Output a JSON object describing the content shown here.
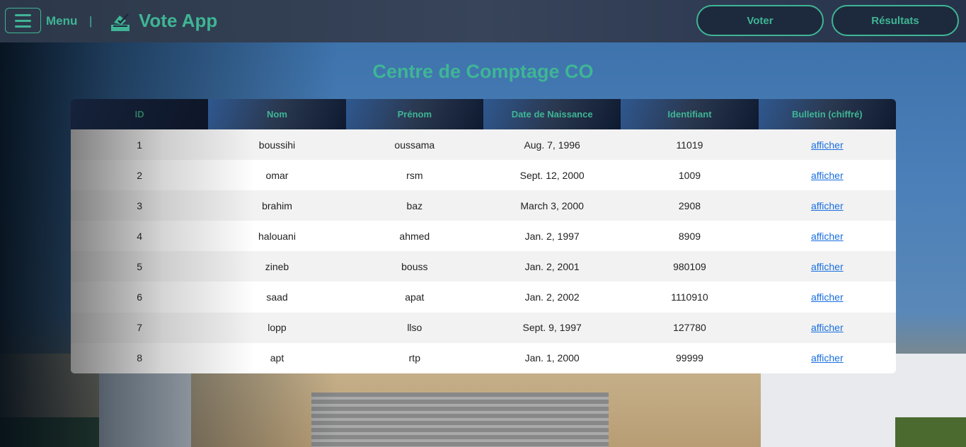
{
  "header": {
    "menu_label": "Menu",
    "separator": "|",
    "app_title": "Vote App",
    "logo_icon": "ballot-box-icon",
    "nav": [
      {
        "label": "Voter"
      },
      {
        "label": "Résultats"
      }
    ],
    "accent": "#3fb595"
  },
  "page_title": "Centre de Comptage CO",
  "table": {
    "columns": [
      "ID",
      "Nom",
      "Prénom",
      "Date de Naissance",
      "Identifiant",
      "Bulletin (chiffré)"
    ],
    "rows": [
      [
        "1",
        "boussihi",
        "oussama",
        "Aug. 7, 1996",
        "11019",
        "afficher"
      ],
      [
        "2",
        "omar",
        "rsm",
        "Sept. 12, 2000",
        "1009",
        "afficher"
      ],
      [
        "3",
        "brahim",
        "baz",
        "March 3, 2000",
        "2908",
        "afficher"
      ],
      [
        "4",
        "halouani",
        "ahmed",
        "Jan. 2, 1997",
        "8909",
        "afficher"
      ],
      [
        "5",
        "zineb",
        "bouss",
        "Jan. 2, 2001",
        "980109",
        "afficher"
      ],
      [
        "6",
        "saad",
        "apat",
        "Jan. 2, 2002",
        "1110910",
        "afficher"
      ],
      [
        "7",
        "lopp",
        "llso",
        "Sept. 9, 1997",
        "127780",
        "afficher"
      ],
      [
        "8",
        "apt",
        "rtp",
        "Jan. 1, 2000",
        "99999",
        "afficher"
      ]
    ]
  }
}
